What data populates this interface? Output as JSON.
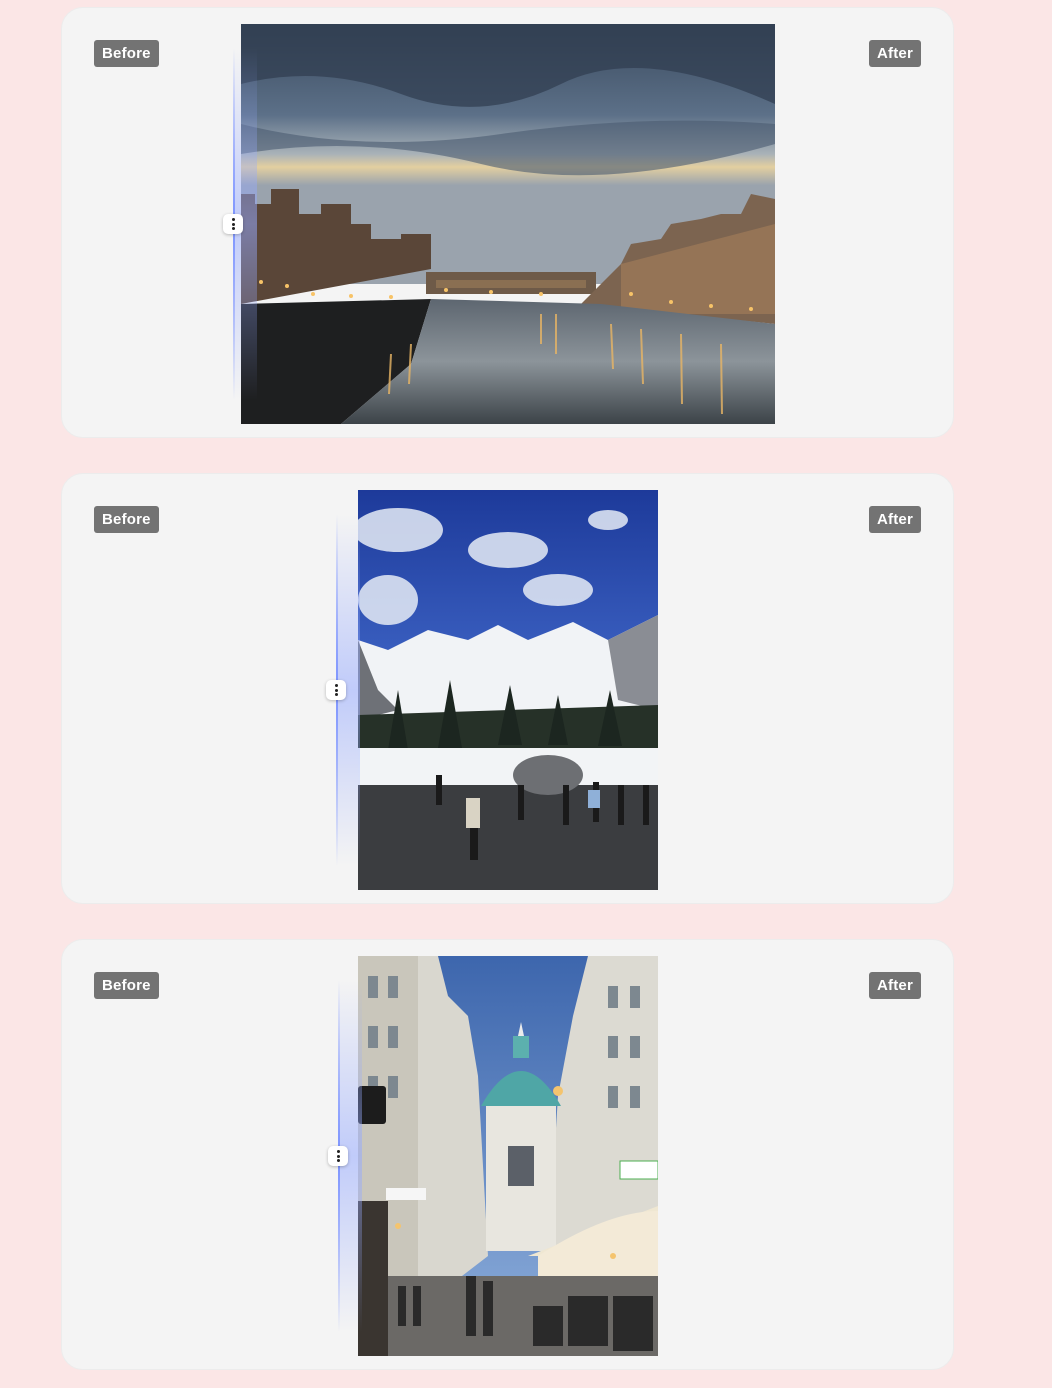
{
  "comparisons": [
    {
      "before_label": "Before",
      "after_label": "After",
      "image_subject": "river-bridge-at-dusk"
    },
    {
      "before_label": "Before",
      "after_label": "After",
      "image_subject": "snowy-mountains-with-tourists"
    },
    {
      "before_label": "Before",
      "after_label": "After",
      "image_subject": "city-street-with-domed-church"
    }
  ],
  "colors": {
    "page_background": "#fbe6e6",
    "card_background": "#f4f4f4",
    "badge_background": "#737373",
    "badge_text": "#ffffff",
    "slider_accent": "#7d94ff"
  },
  "icons": {
    "handle": "vertical-ellipsis-icon"
  }
}
